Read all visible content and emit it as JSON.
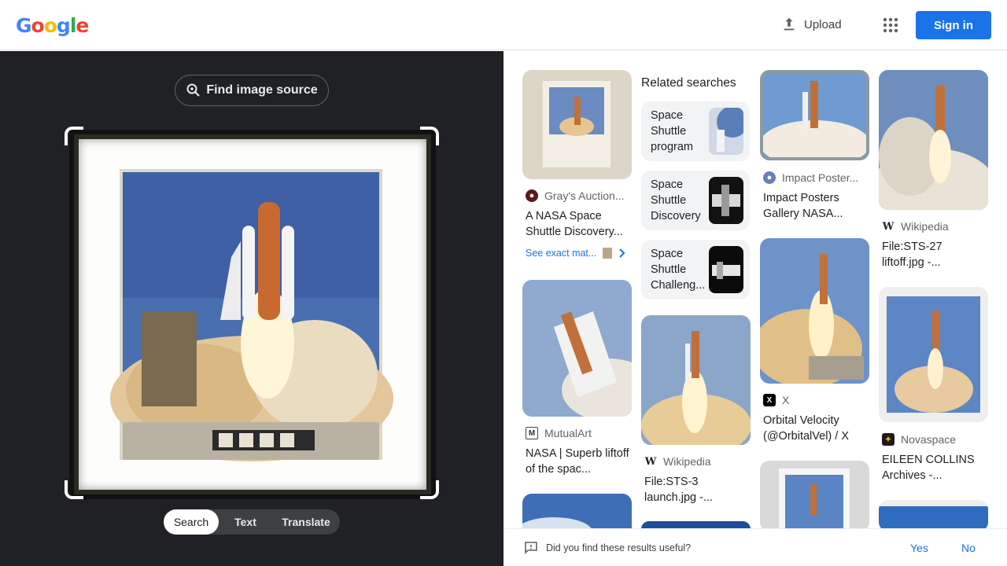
{
  "header": {
    "logo": [
      "G",
      "o",
      "o",
      "g",
      "l",
      "e"
    ],
    "upload_label": "Upload",
    "signin_label": "Sign in"
  },
  "lens": {
    "find_source_label": "Find image source",
    "modes": [
      "Search",
      "Text",
      "Translate"
    ],
    "active_mode": "Search"
  },
  "results": {
    "related_heading": "Related searches",
    "related": [
      {
        "label": "Space Shuttle program"
      },
      {
        "label": "Space Shuttle Discovery"
      },
      {
        "label": "Space Shuttle Challeng..."
      }
    ],
    "items": [
      {
        "source": "Gray's Auction...",
        "title": "A NASA Space Shuttle Discovery..."
      },
      {
        "source": "MutualArt",
        "title": "NASA | Superb liftoff of the spac..."
      },
      {
        "source": "Wikipedia",
        "title": "File:STS-3 launch.jpg -..."
      },
      {
        "source": "Impact Poster...",
        "title": "Impact Posters Gallery NASA..."
      },
      {
        "source": "X",
        "title": "Orbital Velocity (@OrbitalVel) / X"
      },
      {
        "source": "Wikipedia",
        "title": "File:STS-27 liftoff.jpg -..."
      },
      {
        "source": "Novaspace",
        "title": "EILEEN COLLINS Archives -..."
      }
    ],
    "exact_matches_label": "See exact mat..."
  },
  "footer": {
    "question": "Did you find these results useful?",
    "yes": "Yes",
    "no": "No"
  },
  "colors": {
    "accent": "#1a73e8",
    "dark_panel": "#202124"
  }
}
